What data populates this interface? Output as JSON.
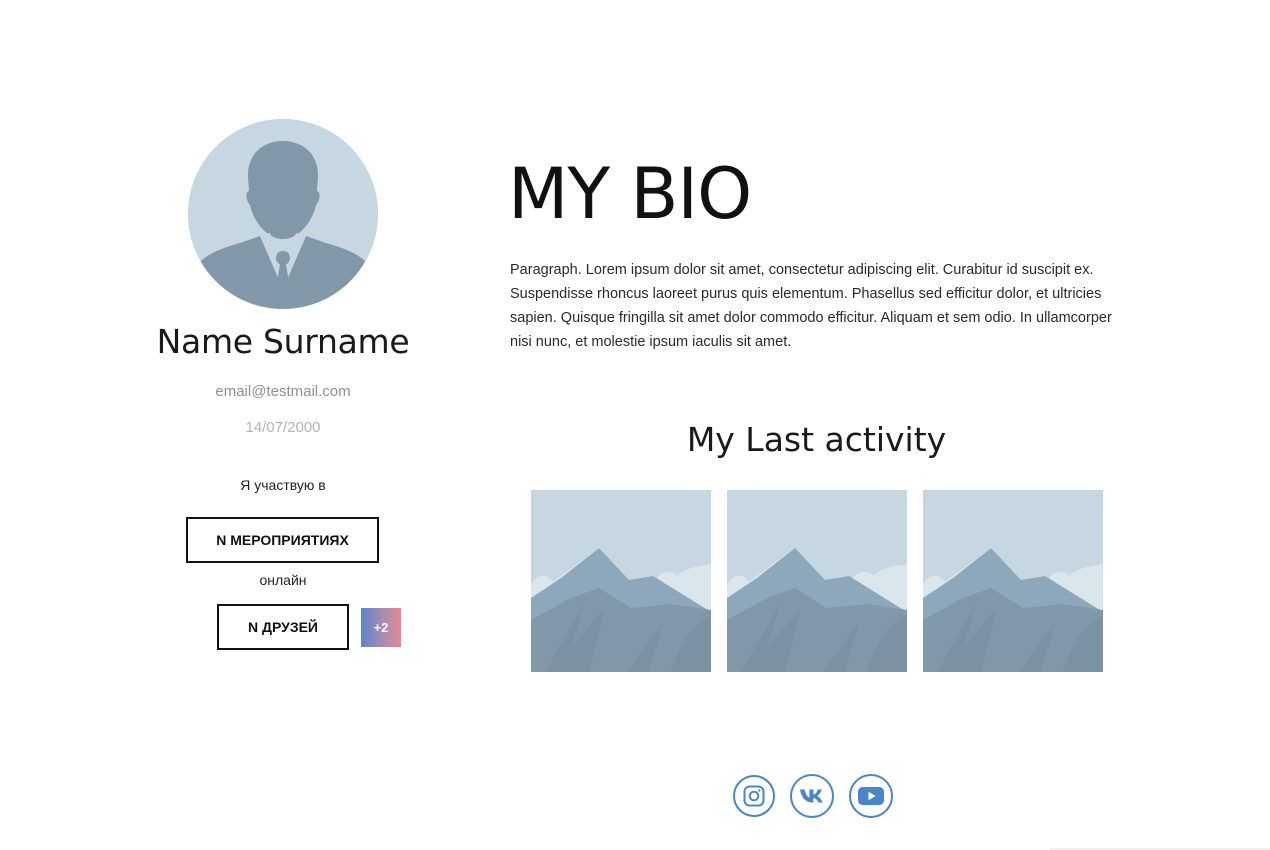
{
  "profile": {
    "name": "Name Surname",
    "email": "email@testmail.com",
    "birth_date": "14/07/2000",
    "participate_label": "Я участвую в",
    "events_button": "N МЕРОПРИЯТИЯХ",
    "online_label": "онлайн",
    "friends_button": "N ДРУЗЕЙ",
    "more_friends_badge": "+2"
  },
  "bio": {
    "title": "MY BIO",
    "paragraph": "Paragraph. Lorem ipsum dolor sit amet, consectetur adipiscing elit. Curabitur id suscipit ex. Suspendisse rhoncus laoreet purus quis elementum. Phasellus sed efficitur dolor, et ultricies sapien. Quisque fringilla sit amet dolor commodo efficitur. Aliquam et sem odio. In ullamcorper nisi nunc, et molestie ipsum iaculis sit amet."
  },
  "activity": {
    "title": "My Last activity",
    "items": [
      "mountain-placeholder-image",
      "mountain-placeholder-image",
      "mountain-placeholder-image"
    ]
  },
  "social": {
    "icons": [
      "instagram-icon",
      "vk-icon",
      "youtube-icon"
    ]
  },
  "colors": {
    "placeholder_bg": "#c6d7e1",
    "placeholder_fg": "#8098a8",
    "social_accent": "#4a86c5",
    "badge_gradient_start": "#5c85c8",
    "badge_gradient_end": "#e28b94"
  }
}
